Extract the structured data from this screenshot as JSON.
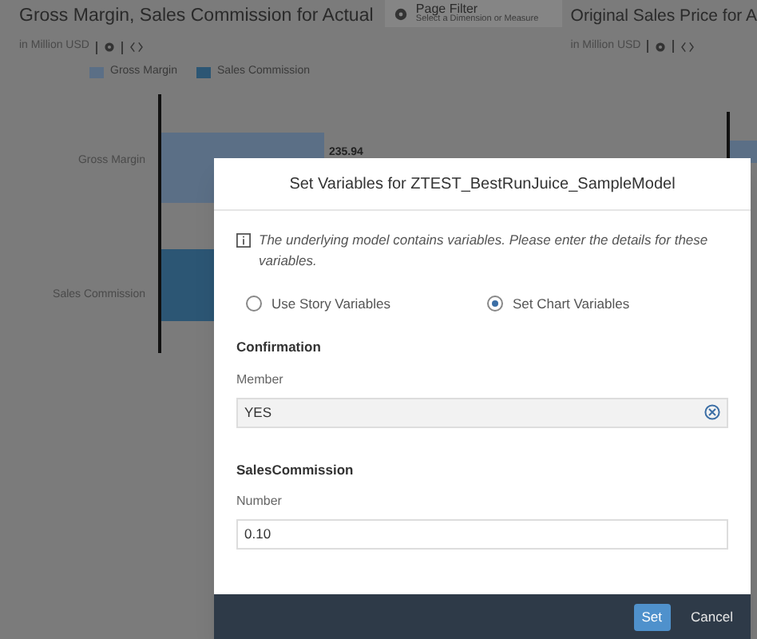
{
  "left_chart": {
    "title": "Gross Margin, Sales Commission for Actual",
    "unit": "in Million USD",
    "legend": [
      {
        "label": "Gross Margin",
        "color": "#5b6f86"
      },
      {
        "label": "Sales Commission",
        "color": "#2c5674"
      }
    ],
    "categories": [
      "Gross Margin",
      "Sales Commission"
    ],
    "value_label": "235.94"
  },
  "page_filter": {
    "title": "Page Filter",
    "hint": "Select a Dimension or Measure"
  },
  "right_chart": {
    "title": "Original Sales Price for A",
    "unit": "in Million USD"
  },
  "dialog": {
    "title": "Set Variables for ZTEST_BestRunJuice_SampleModel",
    "info": "The underlying model contains variables. Please enter the details for these variables.",
    "options": [
      {
        "label": "Use Story Variables",
        "selected": false
      },
      {
        "label": "Set Chart Variables",
        "selected": true
      }
    ],
    "sections": [
      {
        "heading": "Confirmation",
        "label": "Member",
        "value": "YES",
        "clearable": true
      },
      {
        "heading": "SalesCommission",
        "label": "Number",
        "value": "0.10",
        "clearable": false
      }
    ],
    "buttons": [
      {
        "label": "Set",
        "kind": "primary"
      },
      {
        "label": "Cancel",
        "kind": "plain"
      }
    ]
  }
}
